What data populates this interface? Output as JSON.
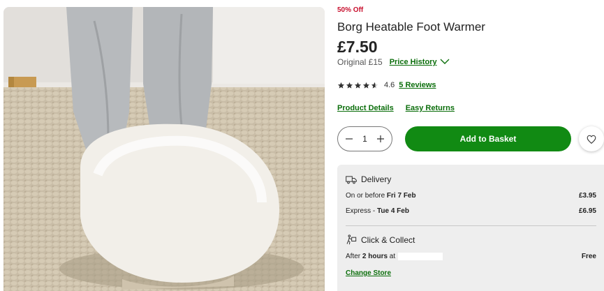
{
  "product": {
    "discount_badge": "50% Off",
    "title": "Borg Heatable Foot Warmer",
    "price": "£7.50",
    "original_price": "Original £15",
    "price_history_label": "Price History",
    "rating": 4.6,
    "rating_text": "4.6",
    "reviews_label": "5 Reviews",
    "product_details_label": "Product Details",
    "easy_returns_label": "Easy Returns",
    "image_alt": "Feet in grey joggers resting in a white borg foot warmer on a woven rug"
  },
  "purchase": {
    "quantity": "1",
    "add_to_basket_label": "Add to Basket",
    "accent_color": "#118a13",
    "wishlist_icon": "heart-icon"
  },
  "delivery": {
    "heading": "Delivery",
    "icon": "delivery-truck-icon",
    "options": [
      {
        "prefix": "On or before ",
        "date": "Fri 7 Feb",
        "price": "£3.95"
      },
      {
        "prefix": "Express - ",
        "date": "Tue 4 Feb",
        "price": "£6.95"
      }
    ]
  },
  "click_collect": {
    "heading": "Click & Collect",
    "icon": "click-collect-icon",
    "prefix": "After ",
    "time": "2 hours",
    "suffix": " at",
    "price": "Free",
    "change_store_label": "Change Store"
  },
  "colors": {
    "discount": "#c8102e",
    "link": "#0b6e0b",
    "panel_bg": "#eeeeee"
  }
}
